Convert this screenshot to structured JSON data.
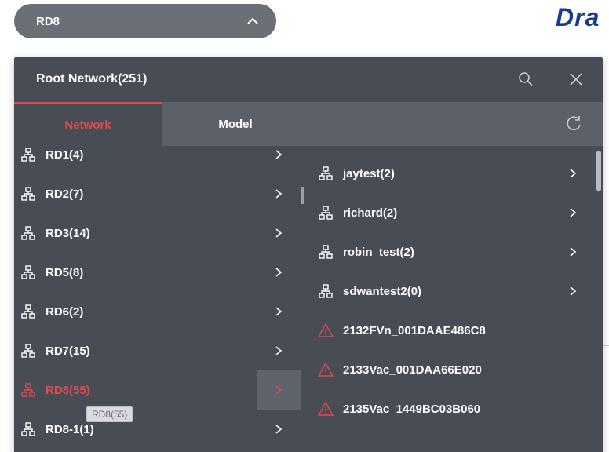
{
  "selector": {
    "value": "RD8"
  },
  "brand": "Dra",
  "panel": {
    "title": "Root Network(251)",
    "tabs": [
      {
        "label": "Network",
        "active": true
      },
      {
        "label": "Model",
        "active": false
      }
    ]
  },
  "left_list": [
    {
      "label": "RD1(4)",
      "selected": false
    },
    {
      "label": "RD2(7)",
      "selected": false
    },
    {
      "label": "RD3(14)",
      "selected": false
    },
    {
      "label": "RD5(8)",
      "selected": false
    },
    {
      "label": "RD6(2)",
      "selected": false
    },
    {
      "label": "RD7(15)",
      "selected": false
    },
    {
      "label": "RD8(55)",
      "selected": true
    },
    {
      "label": "RD8-1(1)",
      "selected": false
    }
  ],
  "tooltip": "RD8(55)",
  "right_list": [
    {
      "label": "jaytest(2)",
      "icon": "network-icon"
    },
    {
      "label": "richard(2)",
      "icon": "network-icon"
    },
    {
      "label": "robin_test(2)",
      "icon": "network-icon"
    },
    {
      "label": "sdwantest2(0)",
      "icon": "network-icon"
    },
    {
      "label": "2132FVn_001DAAE486C8",
      "icon": "warning-icon"
    },
    {
      "label": "2133Vac_001DAA66E020",
      "icon": "warning-icon"
    },
    {
      "label": "2135Vac_1449BC03B060",
      "icon": "warning-icon"
    }
  ],
  "colors": {
    "accent": "#e04a4f",
    "panel": "#474c55",
    "selector": "#6b6f76"
  }
}
